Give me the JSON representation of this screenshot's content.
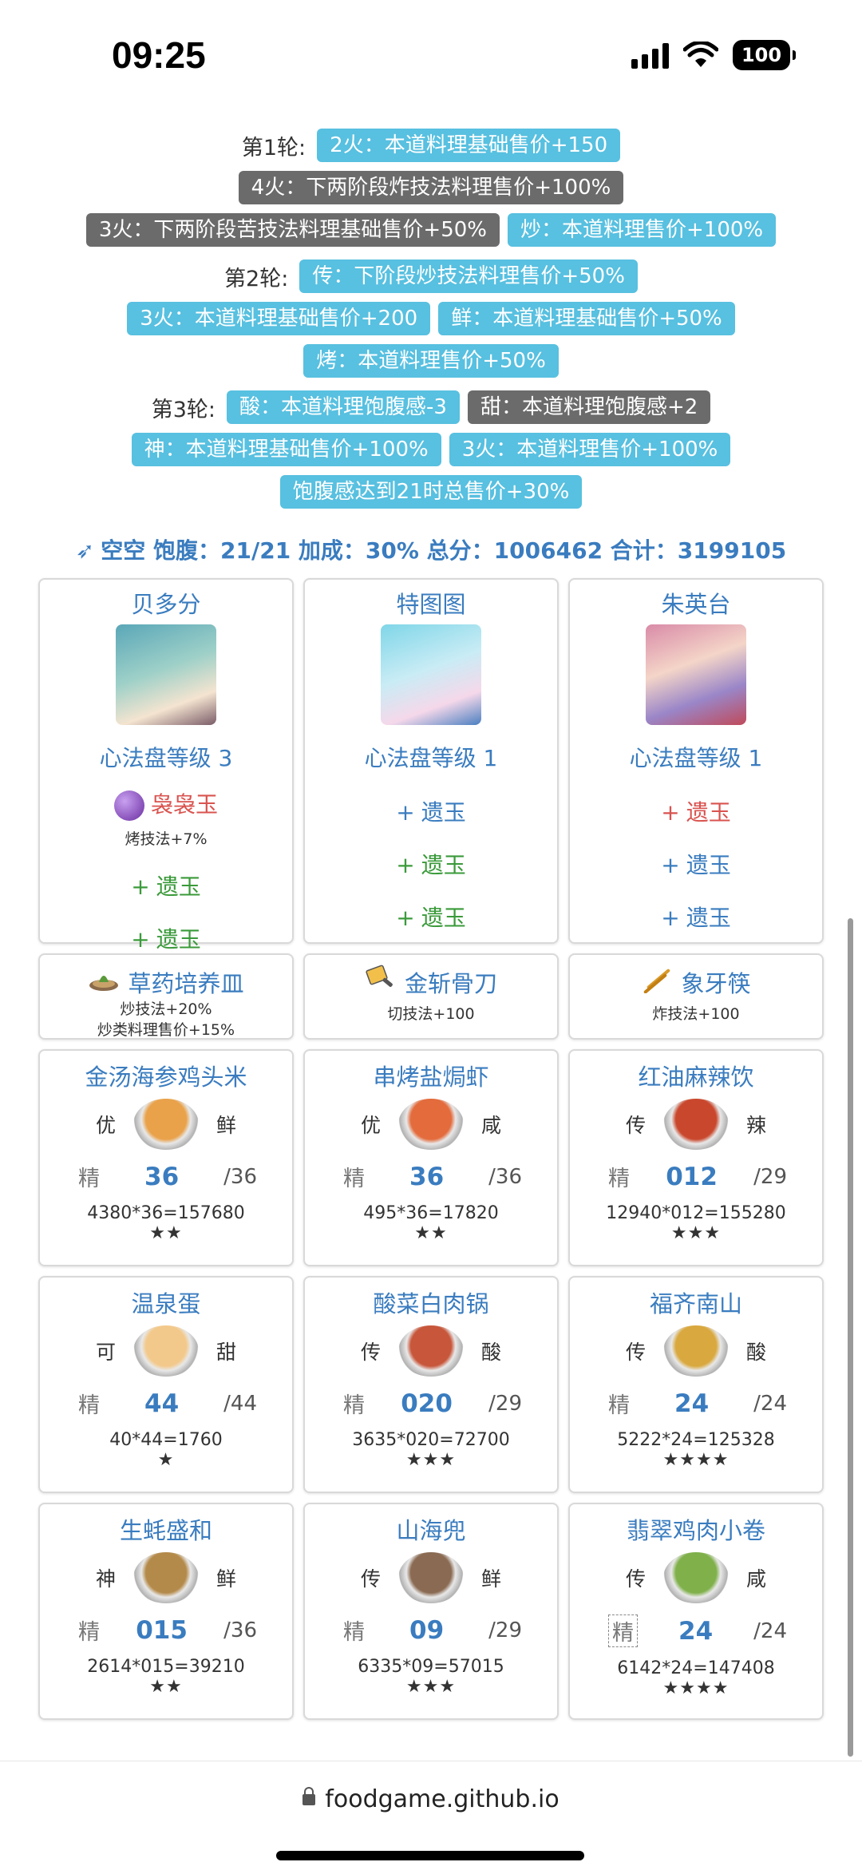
{
  "status_bar": {
    "time": "09:25",
    "battery": "100"
  },
  "rounds": [
    {
      "label": "第1轮:",
      "rows": [
        [
          {
            "text": "2火：本道料理基础售价+150",
            "color": "blue"
          }
        ],
        [
          {
            "text": "4火：下两阶段炸技法料理售价+100%",
            "color": "gray"
          }
        ],
        [
          {
            "text": "3火：下两阶段苦技法料理基础售价+50%",
            "color": "gray"
          },
          {
            "text": "炒：本道料理售价+100%",
            "color": "blue"
          }
        ]
      ]
    },
    {
      "label": "第2轮:",
      "rows": [
        [
          {
            "text": "传：下阶段炒技法料理售价+50%",
            "color": "blue"
          }
        ],
        [
          {
            "text": "3火：本道料理基础售价+200",
            "color": "blue"
          },
          {
            "text": "鲜：本道料理基础售价+50%",
            "color": "blue"
          }
        ],
        [
          {
            "text": "烤：本道料理售价+50%",
            "color": "blue"
          }
        ]
      ]
    },
    {
      "label": "第3轮:",
      "rows": [
        [
          {
            "text": "酸：本道料理饱腹感-3",
            "color": "blue"
          },
          {
            "text": "甜：本道料理饱腹感+2",
            "color": "gray"
          }
        ],
        [
          {
            "text": "神：本道料理基础售价+100%",
            "color": "blue"
          },
          {
            "text": "3火：本道料理售价+100%",
            "color": "blue"
          }
        ],
        [
          {
            "text": "饱腹感达到21时总售价+30%",
            "color": "blue"
          }
        ]
      ]
    }
  ],
  "summary": "空空 饱腹：21/21 加成：30% 总分：1006462 合计：3199105",
  "chefs": [
    {
      "name": "贝多分",
      "level": "心法盘等级 3",
      "gem_name": "袅袅玉",
      "gem_desc": "烤技法+7%",
      "slots": [
        {
          "label": "遗玉",
          "color": "green"
        },
        {
          "label": "遗玉",
          "color": "green"
        }
      ]
    },
    {
      "name": "特图图",
      "level": "心法盘等级 1",
      "slots": [
        {
          "label": "遗玉",
          "color": "blue"
        },
        {
          "label": "遗玉",
          "color": "green"
        },
        {
          "label": "遗玉",
          "color": "green"
        }
      ]
    },
    {
      "name": "朱英台",
      "level": "心法盘等级 1",
      "slots": [
        {
          "label": "遗玉",
          "color": "red"
        },
        {
          "label": "遗玉",
          "color": "blue"
        },
        {
          "label": "遗玉",
          "color": "blue"
        }
      ]
    }
  ],
  "equipment": [
    {
      "name": "草药培养皿",
      "desc": [
        "炒技法+20%",
        "炒类料理售价+15%"
      ],
      "icon": "petri-dish-icon"
    },
    {
      "name": "金斩骨刀",
      "desc": [
        "切技法+100"
      ],
      "icon": "cleaver-icon"
    },
    {
      "name": "象牙筷",
      "desc": [
        "炸技法+100"
      ],
      "icon": "chopsticks-icon"
    }
  ],
  "dishes": [
    {
      "name": "金汤海参鸡头米",
      "left": "优",
      "right": "鲜",
      "jing": "精",
      "qty": "36",
      "max": "/36",
      "formula": "4380*36=157680",
      "stars": "★★",
      "color": "#e9a24a"
    },
    {
      "name": "串烤盐焗虾",
      "left": "优",
      "right": "咸",
      "jing": "精",
      "qty": "36",
      "max": "/36",
      "formula": "495*36=17820",
      "stars": "★★",
      "color": "#e36b3c"
    },
    {
      "name": "红油麻辣饮",
      "left": "传",
      "right": "辣",
      "jing": "精",
      "qty": "012",
      "max": "/29",
      "formula": "12940*012=155280",
      "stars": "★★★",
      "color": "#c9482d"
    },
    {
      "name": "温泉蛋",
      "left": "可",
      "right": "甜",
      "jing": "精",
      "qty": "44",
      "max": "/44",
      "formula": "40*44=1760",
      "stars": "★",
      "color": "#f3c98b"
    },
    {
      "name": "酸菜白肉锅",
      "left": "传",
      "right": "酸",
      "jing": "精",
      "qty": "020",
      "max": "/29",
      "formula": "3635*020=72700",
      "stars": "★★★",
      "color": "#c7563a"
    },
    {
      "name": "福齐南山",
      "left": "传",
      "right": "酸",
      "jing": "精",
      "qty": "24",
      "max": "/24",
      "formula": "5222*24=125328",
      "stars": "★★★★",
      "color": "#d9a83e"
    },
    {
      "name": "生蚝盛和",
      "left": "神",
      "right": "鲜",
      "jing": "精",
      "qty": "015",
      "max": "/36",
      "formula": "2614*015=39210",
      "stars": "★★",
      "color": "#b48a4a"
    },
    {
      "name": "山海兜",
      "left": "传",
      "right": "鲜",
      "jing": "精",
      "qty": "09",
      "max": "/29",
      "formula": "6335*09=57015",
      "stars": "★★★",
      "color": "#8a6a52"
    },
    {
      "name": "翡翠鸡肉小卷",
      "left": "传",
      "right": "咸",
      "jing": "精",
      "qty": "24",
      "max": "/24",
      "formula": "6142*24=147408",
      "stars": "★★★★",
      "color": "#7fb04a"
    }
  ],
  "url": "foodgame.github.io"
}
